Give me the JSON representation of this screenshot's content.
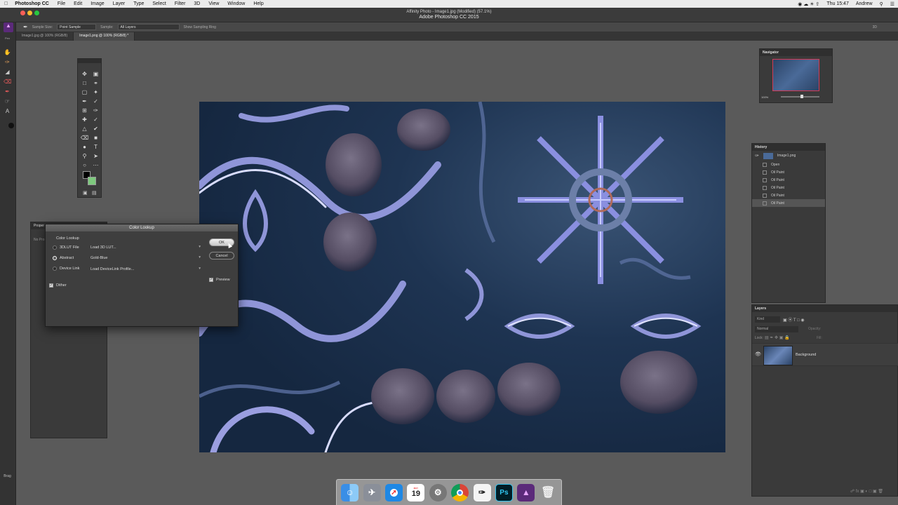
{
  "menubar": {
    "app_name": "Photoshop CC",
    "items": [
      "File",
      "Edit",
      "Image",
      "Layer",
      "Type",
      "Select",
      "Filter",
      "3D",
      "View",
      "Window",
      "Help"
    ],
    "clock": "Thu 15:47",
    "user": "Andrew"
  },
  "window": {
    "title_line1": "Affinity Photo - Image1.jpg (Modified) (57.1%)",
    "title_line2": "Adobe Photoshop CC 2015"
  },
  "options_bar": {
    "sample_size_label": "Sample Size:",
    "sample_size_value": "Point Sample",
    "sample_label": "Sample:",
    "sample_value": "All Layers",
    "sampling_ring": "Show Sampling Ring",
    "right_value": "3D"
  },
  "doc_tabs": [
    {
      "label": "Image1.jpg @ 100% (RGB/8)"
    },
    {
      "label": "Image1.png @ 100% (RGB/8) *"
    }
  ],
  "left_strip": {
    "bottom_label": "Brag",
    "top_label": "Pen"
  },
  "properties_panel": {
    "title": "Proper",
    "body": "No Pro"
  },
  "navigator": {
    "title": "Navigator",
    "zoom": "100%"
  },
  "history": {
    "title": "History",
    "snapshot": "Image1.png",
    "steps": [
      "Open",
      "Oil Paint",
      "Oil Paint",
      "Oil Paint",
      "Oil Paint",
      "Oil Paint"
    ]
  },
  "layers": {
    "title": "Layers",
    "kind": "Kind",
    "blend": "Normal",
    "opacity_label": "Opacity:",
    "lock_label": "Lock:",
    "fill_label": "Fill:",
    "layer_name": "Background"
  },
  "dialog": {
    "title": "Color Lookup",
    "group_label": "Color Lookup",
    "rows": [
      {
        "label": "3DLUT File",
        "value": "Load 3D LUT...",
        "selected": false
      },
      {
        "label": "Abstract",
        "value": "Gold-Blue",
        "selected": true
      },
      {
        "label": "Device Link",
        "value": "Load DeviceLink Profile...",
        "selected": false
      }
    ],
    "dither_label": "Dither",
    "ok_label": "OK",
    "cancel_label": "Cancel",
    "preview_label": "Preview"
  },
  "dock": {
    "icons": [
      "finder-icon",
      "launchpad-icon",
      "safari-icon",
      "calendar-icon",
      "system-preferences-icon",
      "chrome-icon",
      "pen-app-icon",
      "photoshop-icon",
      "affinity-photo-icon",
      "trash-icon"
    ],
    "calendar_day": "19",
    "ps_label": "Ps"
  }
}
